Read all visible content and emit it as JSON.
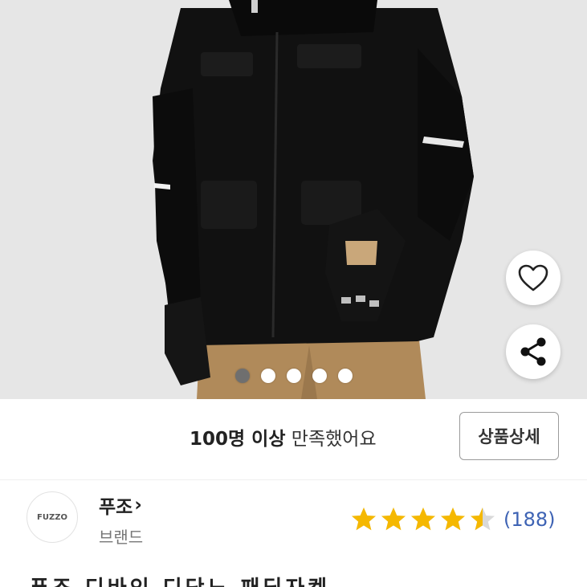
{
  "hero": {
    "image_alt": "black padded jacket with khaki pants",
    "like_icon": "heart-outline-icon",
    "share_icon": "share-icon",
    "carousel": {
      "total": 5,
      "active_index": 0
    }
  },
  "satisfaction": {
    "emphasis": "100명 이상",
    "rest": " 만족했어요",
    "detail_button": "상품상세"
  },
  "brand": {
    "logo_text": "FUZZO",
    "name": "푸조",
    "chevron": "›",
    "label": "브랜드",
    "rating": {
      "value": 4.5,
      "max": 5,
      "count_text": "(188)",
      "star_color": "#f5b800",
      "empty_color": "#d9d9d9"
    }
  },
  "product": {
    "title": "푸조 디바인 디단노 패딩자켓"
  },
  "colors": {
    "accent_blue": "#3e63b4",
    "hero_bg": "#e6e6e6"
  }
}
